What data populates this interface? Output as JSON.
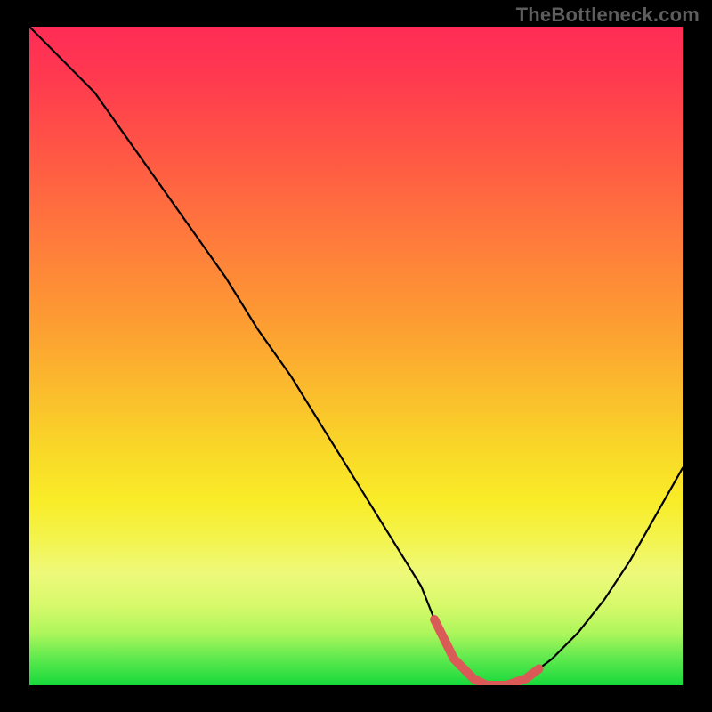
{
  "watermark": "TheBottleneck.com",
  "chart_data": {
    "type": "line",
    "title": "",
    "xlabel": "",
    "ylabel": "",
    "xlim": [
      0,
      100
    ],
    "ylim": [
      0,
      100
    ],
    "grid": false,
    "legend": false,
    "series": [
      {
        "name": "bottleneck-curve",
        "x": [
          0,
          5,
          10,
          15,
          20,
          25,
          30,
          35,
          40,
          45,
          50,
          55,
          60,
          62,
          65,
          68,
          70,
          73,
          76,
          80,
          84,
          88,
          92,
          96,
          100
        ],
        "values": [
          100,
          95,
          90,
          83,
          76,
          69,
          62,
          54,
          47,
          39,
          31,
          23,
          15,
          10,
          4,
          1,
          0,
          0,
          1,
          4,
          8,
          13,
          19,
          26,
          33
        ]
      }
    ],
    "trough_highlight": {
      "x_from": 62,
      "x_to": 78
    },
    "background_gradient": {
      "orientation": "vertical_top_to_bottom",
      "stops": [
        {
          "pos": 0.0,
          "color": "#ff2c56"
        },
        {
          "pos": 0.2,
          "color": "#ff5944"
        },
        {
          "pos": 0.44,
          "color": "#fd9a33"
        },
        {
          "pos": 0.64,
          "color": "#f9d728"
        },
        {
          "pos": 0.83,
          "color": "#eef97a"
        },
        {
          "pos": 1.0,
          "color": "#17d93b"
        }
      ]
    }
  }
}
